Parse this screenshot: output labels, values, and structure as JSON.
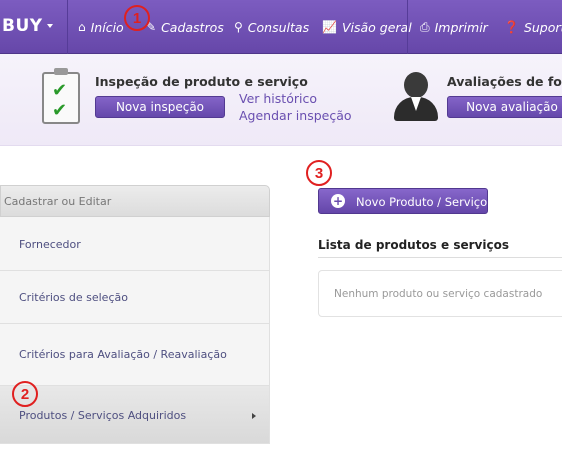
{
  "nav": {
    "brand": "BUY",
    "items": [
      {
        "label": "Início",
        "icon": "home-icon"
      },
      {
        "label": "Cadastros",
        "icon": "pencil-icon"
      },
      {
        "label": "Consultas",
        "icon": "search-icon"
      },
      {
        "label": "Visão geral",
        "icon": "chart-icon"
      },
      {
        "label": "Imprimir",
        "icon": "printer-icon"
      },
      {
        "label": "Suporte",
        "icon": "help-icon"
      }
    ]
  },
  "banner": {
    "inspecao": {
      "title": "Inspeção de produto e serviço",
      "button": "Nova inspeção",
      "links": [
        "Ver histórico",
        "Agendar inspeção"
      ]
    },
    "avaliacoes": {
      "title": "Avaliações de forne",
      "button": "Nova avaliação"
    }
  },
  "sidebar": {
    "header": "Cadastrar ou Editar",
    "items": [
      {
        "label": "Fornecedor"
      },
      {
        "label": "Critérios de seleção"
      },
      {
        "label": "Critérios para Avaliação / Reavaliação"
      },
      {
        "label": "Produtos / Serviços Adquiridos"
      }
    ]
  },
  "main": {
    "new_button": "Novo Produto / Serviço",
    "list_title": "Lista de produtos e serviços",
    "empty_text": "Nenhum produto ou serviço cadastrado"
  },
  "markers": [
    "1",
    "2",
    "3"
  ],
  "colors": {
    "accent": "#6a4cae",
    "marker": "#e02020"
  }
}
